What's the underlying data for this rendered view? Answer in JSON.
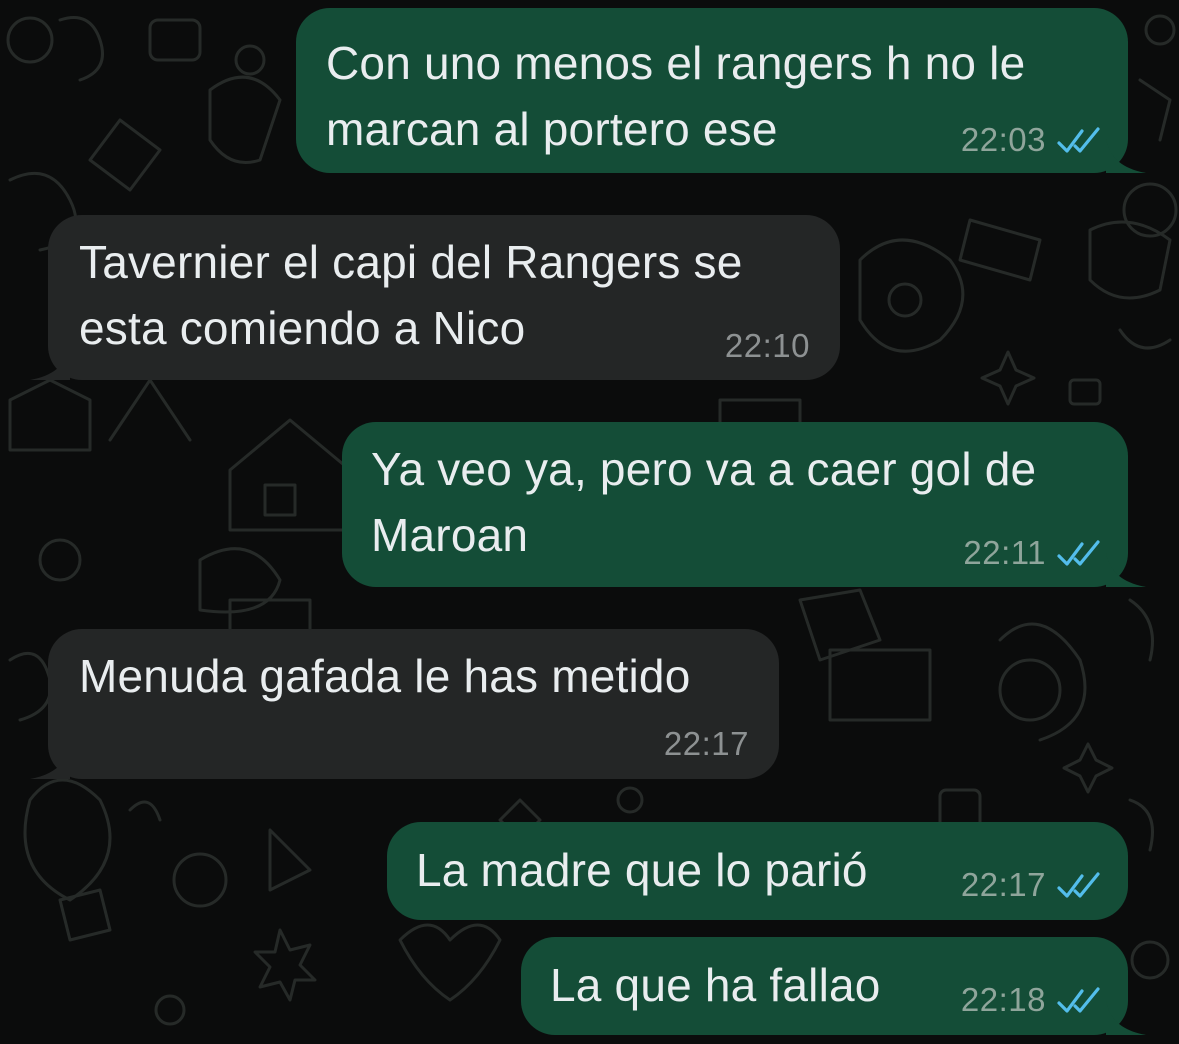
{
  "colors": {
    "outgoing_bubble": "#144d37",
    "incoming_bubble": "#242626",
    "read_ticks": "#53bdeb",
    "background": "#0b0c0c"
  },
  "messages": [
    {
      "direction": "outgoing",
      "lines": [
        "Con uno menos el rangers h no le",
        "marcan al portero ese"
      ],
      "time": "22:03",
      "status": "read",
      "status_icon": "double-check-icon"
    },
    {
      "direction": "incoming",
      "lines": [
        "Tavernier el capi del Rangers se",
        "esta comiendo a Nico"
      ],
      "time": "22:10"
    },
    {
      "direction": "outgoing",
      "lines": [
        "Ya veo ya, pero va a caer gol de",
        "Maroan"
      ],
      "time": "22:11",
      "status": "read",
      "status_icon": "double-check-icon"
    },
    {
      "direction": "incoming",
      "lines": [
        "Menuda gafada le has metido"
      ],
      "time": "22:17"
    },
    {
      "direction": "outgoing",
      "lines": [
        "La madre que lo parió"
      ],
      "time": "22:17",
      "status": "read",
      "status_icon": "double-check-icon"
    },
    {
      "direction": "outgoing",
      "lines": [
        "La que ha fallao"
      ],
      "time": "22:18",
      "status": "read",
      "status_icon": "double-check-icon"
    }
  ]
}
